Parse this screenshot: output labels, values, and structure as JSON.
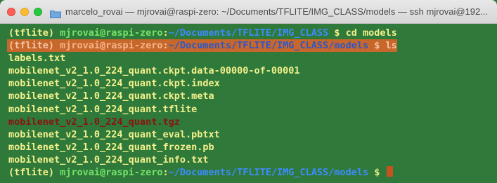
{
  "window": {
    "title": "marcelo_rovai — mjrovai@raspi-zero: ~/Documents/TFLITE/IMG_CLASS/models — ssh mjrovai@192...",
    "colors": {
      "background": "#2f7a3a",
      "text": "#f4f08c",
      "user": "#74e36a",
      "path": "#3d8bff",
      "highlight": "#c7672b",
      "archive": "#8a1410"
    }
  },
  "terminal": {
    "prompt1": {
      "env": "(tflite) ",
      "user": "mjrovai@raspi-zero",
      "colon": ":",
      "path": "~/Documents/TFLITE/IMG_CLASS",
      "cmd": " $ cd models"
    },
    "prompt2": {
      "env": "(tflite) ",
      "user": "mjrovai@raspi-zero",
      "colon": ":",
      "path": "~/Documents/TFLITE/IMG_CLASS/models",
      "cmd": " $ ls"
    },
    "files": [
      "labels.txt",
      "mobilenet_v2_1.0_224_quant.ckpt.data-00000-of-00001",
      "mobilenet_v2_1.0_224_quant.ckpt.index",
      "mobilenet_v2_1.0_224_quant.ckpt.meta",
      "mobilenet_v2_1.0_224_quant.tflite",
      "mobilenet_v2_1.0_224_quant.tgz",
      "mobilenet_v2_1.0_224_quant_eval.pbtxt",
      "mobilenet_v2_1.0_224_quant_frozen.pb",
      "mobilenet_v2_1.0_224_quant_info.txt"
    ],
    "prompt3": {
      "env": "(tflite) ",
      "user": "mjrovai@raspi-zero",
      "colon": ":",
      "path": "~/Documents/TFLITE/IMG_CLASS/models",
      "cmd": " $ "
    }
  }
}
